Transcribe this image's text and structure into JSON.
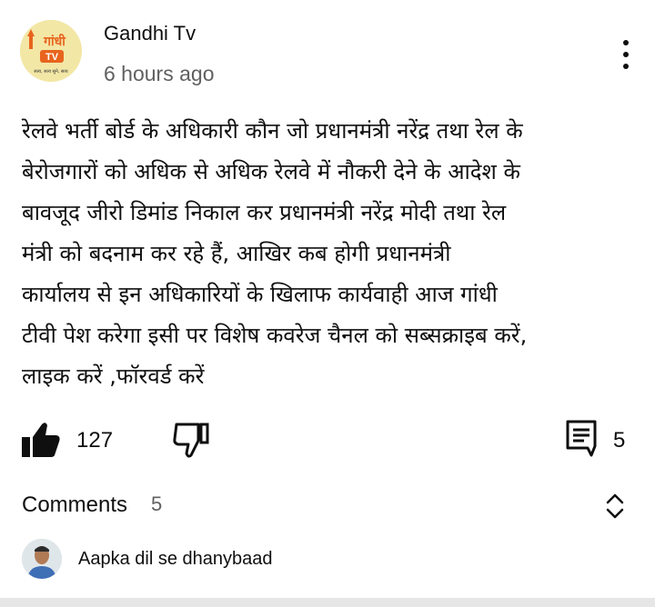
{
  "post": {
    "channel_name": "Gandhi Tv",
    "time_ago": "6 hours ago",
    "avatar": {
      "logo_text": "गांधी",
      "badge_text": "TV",
      "tagline": "सत्य, सत्य सुने, सत्य"
    },
    "text": "रेलवे भर्ती बोर्ड के अधिकारी कौन जो प्रधानमंत्री नरेंद्र तथा रेल के\nबेरोजगारों को अधिक से अधिक रेलवे में नौकरी देने के आदेश के\nबावजूद जीरो डिमांड निकाल कर प्रधानमंत्री नरेंद्र मोदी तथा रेल\nमंत्री को बदनाम कर रहे हैं, आखिर  कब होगी प्रधानमंत्री\nकार्यालय से इन अधिकारियों के खिलाफ कार्यवाही आज गांधी\nटीवी पेश करेगा इसी पर विशेष कवरेज चैनल को सब्सक्राइब करें,\nलाइक करें ,फॉरवर्ड करें"
  },
  "actions": {
    "like_count": "127",
    "comment_count": "5"
  },
  "comments": {
    "label": "Comments",
    "count": "5",
    "first_comment": "Aapka dil se dhanybaad"
  },
  "colors": {
    "text_primary": "#0f0f0f",
    "text_secondary": "#606060",
    "avatar_gold": "#f3e7a6",
    "logo_orange": "#e8641e",
    "logo_green": "#2e8b3a"
  }
}
